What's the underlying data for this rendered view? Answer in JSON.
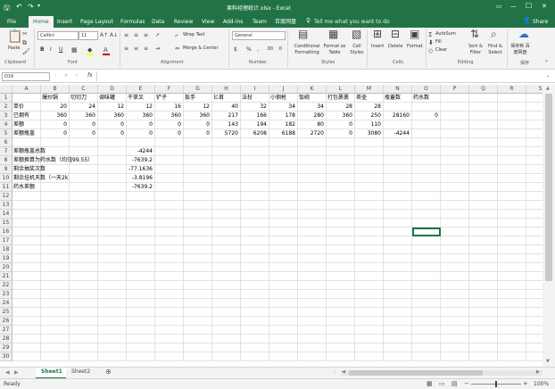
{
  "window": {
    "title": "果料经理统计.xlsx - Excel",
    "minimize": "—",
    "maximize": "☐",
    "close": "✕"
  },
  "ribbon_tabs": [
    "File",
    "Home",
    "Insert",
    "Page Layout",
    "Formulas",
    "Data",
    "Review",
    "View",
    "Add-ins",
    "Team",
    "百度网盘"
  ],
  "tell_me": "Tell me what you want to do",
  "share_label": "Share",
  "ribbon": {
    "paste": "Paste",
    "clipboard_group": "Clipboard",
    "font_name": "Calibri",
    "font_size": "11",
    "font_group": "Font",
    "bold": "B",
    "italic": "I",
    "underline": "U",
    "wrap_text": "Wrap Text",
    "merge_center": "Merge & Center",
    "alignment_group": "Alignment",
    "number_format": "General",
    "currency": "$",
    "percent": "%",
    "comma": ",",
    "dec_inc": ".00",
    "dec_dec": ".0",
    "number_group": "Number",
    "conditional_formatting": "Conditional Formatting",
    "format_as_table": "Format as Table",
    "cell_styles": "Cell Styles",
    "styles_group": "Styles",
    "insert": "Insert",
    "delete": "Delete",
    "format": "Format",
    "cells_group": "Cells",
    "autosum": "AutoSum",
    "fill": "Fill",
    "clear": "Clear",
    "sort_filter": "Sort & Filter",
    "find_select": "Find & Select",
    "editing_group": "Editing",
    "save_baidu": "保存到 百度网盘",
    "save_group": "保存"
  },
  "formula_bar": {
    "name_box": "O16",
    "fx": "fx",
    "value": ""
  },
  "columns": [
    "A",
    "B",
    "C",
    "D",
    "E",
    "F",
    "G",
    "H",
    "I",
    "J",
    "K",
    "L",
    "M",
    "N",
    "O",
    "P",
    "Q",
    "R",
    "S"
  ],
  "row_count": 30,
  "cells": [
    {
      "r": 1,
      "c": "B",
      "v": "爆炒锅",
      "t": "s"
    },
    {
      "r": 1,
      "c": "C",
      "v": "切切刀",
      "t": "s"
    },
    {
      "r": 1,
      "c": "D",
      "v": "调味罐",
      "t": "s"
    },
    {
      "r": 1,
      "c": "E",
      "v": "干草叉",
      "t": "s"
    },
    {
      "r": 1,
      "c": "F",
      "v": "铲子",
      "t": "s"
    },
    {
      "r": 1,
      "c": "G",
      "v": "扳手",
      "t": "s"
    },
    {
      "r": 1,
      "c": "H",
      "v": "匕首",
      "t": "s"
    },
    {
      "r": 1,
      "c": "I",
      "v": "法杖",
      "t": "s"
    },
    {
      "r": 1,
      "c": "J",
      "v": "小钢枪",
      "t": "s"
    },
    {
      "r": 1,
      "c": "K",
      "v": "饭碗",
      "t": "s"
    },
    {
      "r": 1,
      "c": "L",
      "v": "打包裹裹",
      "t": "s"
    },
    {
      "r": 1,
      "c": "M",
      "v": "茶壶",
      "t": "s"
    },
    {
      "r": 1,
      "c": "N",
      "v": "瓶蓋数",
      "t": "s"
    },
    {
      "r": 1,
      "c": "O",
      "v": "药水数",
      "t": "s"
    },
    {
      "r": 2,
      "c": "A",
      "v": "单价",
      "t": "s"
    },
    {
      "r": 2,
      "c": "B",
      "v": "20",
      "t": "n"
    },
    {
      "r": 2,
      "c": "C",
      "v": "24",
      "t": "n"
    },
    {
      "r": 2,
      "c": "D",
      "v": "12",
      "t": "n"
    },
    {
      "r": 2,
      "c": "E",
      "v": "12",
      "t": "n"
    },
    {
      "r": 2,
      "c": "F",
      "v": "16",
      "t": "n"
    },
    {
      "r": 2,
      "c": "G",
      "v": "12",
      "t": "n"
    },
    {
      "r": 2,
      "c": "H",
      "v": "40",
      "t": "n"
    },
    {
      "r": 2,
      "c": "I",
      "v": "32",
      "t": "n"
    },
    {
      "r": 2,
      "c": "J",
      "v": "34",
      "t": "n"
    },
    {
      "r": 2,
      "c": "K",
      "v": "34",
      "t": "n"
    },
    {
      "r": 2,
      "c": "L",
      "v": "28",
      "t": "n"
    },
    {
      "r": 2,
      "c": "M",
      "v": "28",
      "t": "n"
    },
    {
      "r": 3,
      "c": "A",
      "v": "已拥有",
      "t": "s"
    },
    {
      "r": 3,
      "c": "B",
      "v": "360",
      "t": "n"
    },
    {
      "r": 3,
      "c": "C",
      "v": "360",
      "t": "n"
    },
    {
      "r": 3,
      "c": "D",
      "v": "360",
      "t": "n"
    },
    {
      "r": 3,
      "c": "E",
      "v": "360",
      "t": "n"
    },
    {
      "r": 3,
      "c": "F",
      "v": "360",
      "t": "n"
    },
    {
      "r": 3,
      "c": "G",
      "v": "360",
      "t": "n"
    },
    {
      "r": 3,
      "c": "H",
      "v": "217",
      "t": "n"
    },
    {
      "r": 3,
      "c": "I",
      "v": "166",
      "t": "n"
    },
    {
      "r": 3,
      "c": "J",
      "v": "178",
      "t": "n"
    },
    {
      "r": 3,
      "c": "K",
      "v": "280",
      "t": "n"
    },
    {
      "r": 3,
      "c": "L",
      "v": "360",
      "t": "n"
    },
    {
      "r": 3,
      "c": "M",
      "v": "250",
      "t": "n"
    },
    {
      "r": 3,
      "c": "N",
      "v": "28160",
      "t": "n"
    },
    {
      "r": 3,
      "c": "O",
      "v": "0",
      "t": "n"
    },
    {
      "r": 4,
      "c": "A",
      "v": "差额",
      "t": "s"
    },
    {
      "r": 4,
      "c": "B",
      "v": "0",
      "t": "n"
    },
    {
      "r": 4,
      "c": "C",
      "v": "0",
      "t": "n"
    },
    {
      "r": 4,
      "c": "D",
      "v": "0",
      "t": "n"
    },
    {
      "r": 4,
      "c": "E",
      "v": "0",
      "t": "n"
    },
    {
      "r": 4,
      "c": "F",
      "v": "0",
      "t": "n"
    },
    {
      "r": 4,
      "c": "G",
      "v": "0",
      "t": "n"
    },
    {
      "r": 4,
      "c": "H",
      "v": "143",
      "t": "n"
    },
    {
      "r": 4,
      "c": "I",
      "v": "194",
      "t": "n"
    },
    {
      "r": 4,
      "c": "J",
      "v": "182",
      "t": "n"
    },
    {
      "r": 4,
      "c": "K",
      "v": "80",
      "t": "n"
    },
    {
      "r": 4,
      "c": "L",
      "v": "0",
      "t": "n"
    },
    {
      "r": 4,
      "c": "M",
      "v": "110",
      "t": "n"
    },
    {
      "r": 5,
      "c": "A",
      "v": "差额瓶盖",
      "t": "s"
    },
    {
      "r": 5,
      "c": "B",
      "v": "0",
      "t": "n"
    },
    {
      "r": 5,
      "c": "C",
      "v": "0",
      "t": "n"
    },
    {
      "r": 5,
      "c": "D",
      "v": "0",
      "t": "n"
    },
    {
      "r": 5,
      "c": "E",
      "v": "0",
      "t": "n"
    },
    {
      "r": 5,
      "c": "F",
      "v": "0",
      "t": "n"
    },
    {
      "r": 5,
      "c": "G",
      "v": "0",
      "t": "n"
    },
    {
      "r": 5,
      "c": "H",
      "v": "5720",
      "t": "n"
    },
    {
      "r": 5,
      "c": "I",
      "v": "6208",
      "t": "n"
    },
    {
      "r": 5,
      "c": "J",
      "v": "6188",
      "t": "n"
    },
    {
      "r": 5,
      "c": "K",
      "v": "2720",
      "t": "n"
    },
    {
      "r": 5,
      "c": "L",
      "v": "0",
      "t": "n"
    },
    {
      "r": 5,
      "c": "M",
      "v": "3080",
      "t": "n"
    },
    {
      "r": 5,
      "c": "N",
      "v": "-4244",
      "t": "n"
    },
    {
      "r": 7,
      "c": "A",
      "v": "差额瓶盖总数",
      "t": "s"
    },
    {
      "r": 7,
      "c": "E",
      "v": "-4244",
      "t": "n"
    },
    {
      "r": 8,
      "c": "A",
      "v": "差额换算为药水数（均值99.55）",
      "t": "s"
    },
    {
      "r": 8,
      "c": "E",
      "v": "-7639.2",
      "t": "n"
    },
    {
      "r": 9,
      "c": "A",
      "v": "剩余抽奖次数",
      "t": "s"
    },
    {
      "r": 9,
      "c": "E",
      "v": "-77.1636",
      "t": "n"
    },
    {
      "r": 10,
      "c": "A",
      "v": "剩余挂机天数（一天2k）",
      "t": "s"
    },
    {
      "r": 10,
      "c": "E",
      "v": "-3.8196",
      "t": "n"
    },
    {
      "r": 11,
      "c": "A",
      "v": "药水差额",
      "t": "s"
    },
    {
      "r": 11,
      "c": "E",
      "v": "-7639.2",
      "t": "n"
    }
  ],
  "sheets": [
    "Sheet1",
    "Sheet2"
  ],
  "add_sheet": "⊕",
  "status": {
    "ready": "Ready",
    "zoom": "100%",
    "zoom_minus": "−",
    "zoom_plus": "+"
  },
  "colors": {
    "accent": "#217346",
    "ribbon_bg": "#f3f3f3",
    "font_red": "#c00000",
    "fill_yellow": "#ffff00"
  }
}
